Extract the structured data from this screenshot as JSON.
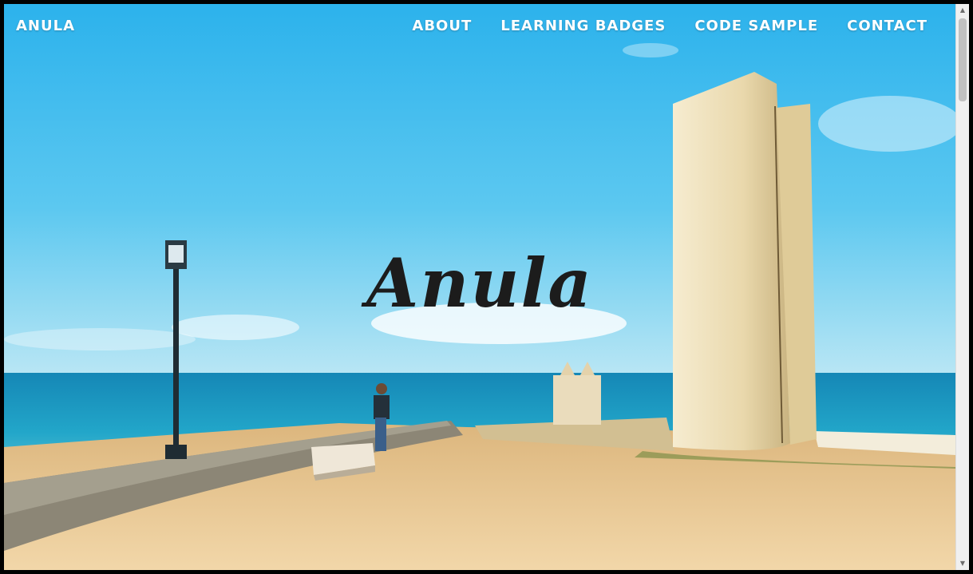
{
  "nav": {
    "brand": "ANULA",
    "items": [
      {
        "label": "ABOUT"
      },
      {
        "label": "LEARNING BADGES"
      },
      {
        "label": "CODE SAMPLE"
      },
      {
        "label": "CONTACT"
      }
    ]
  },
  "hero": {
    "title": "Anula",
    "background_description_colors": {
      "sky_top": "#2fb3ea",
      "sky_horizon": "#a6e0f3",
      "sea": "#1ea8c8",
      "ground": "#e9c894",
      "stone": "#efe0b8"
    }
  },
  "scrollbar": {
    "up_icon": "chevron-up-icon",
    "down_icon": "chevron-down-icon"
  }
}
